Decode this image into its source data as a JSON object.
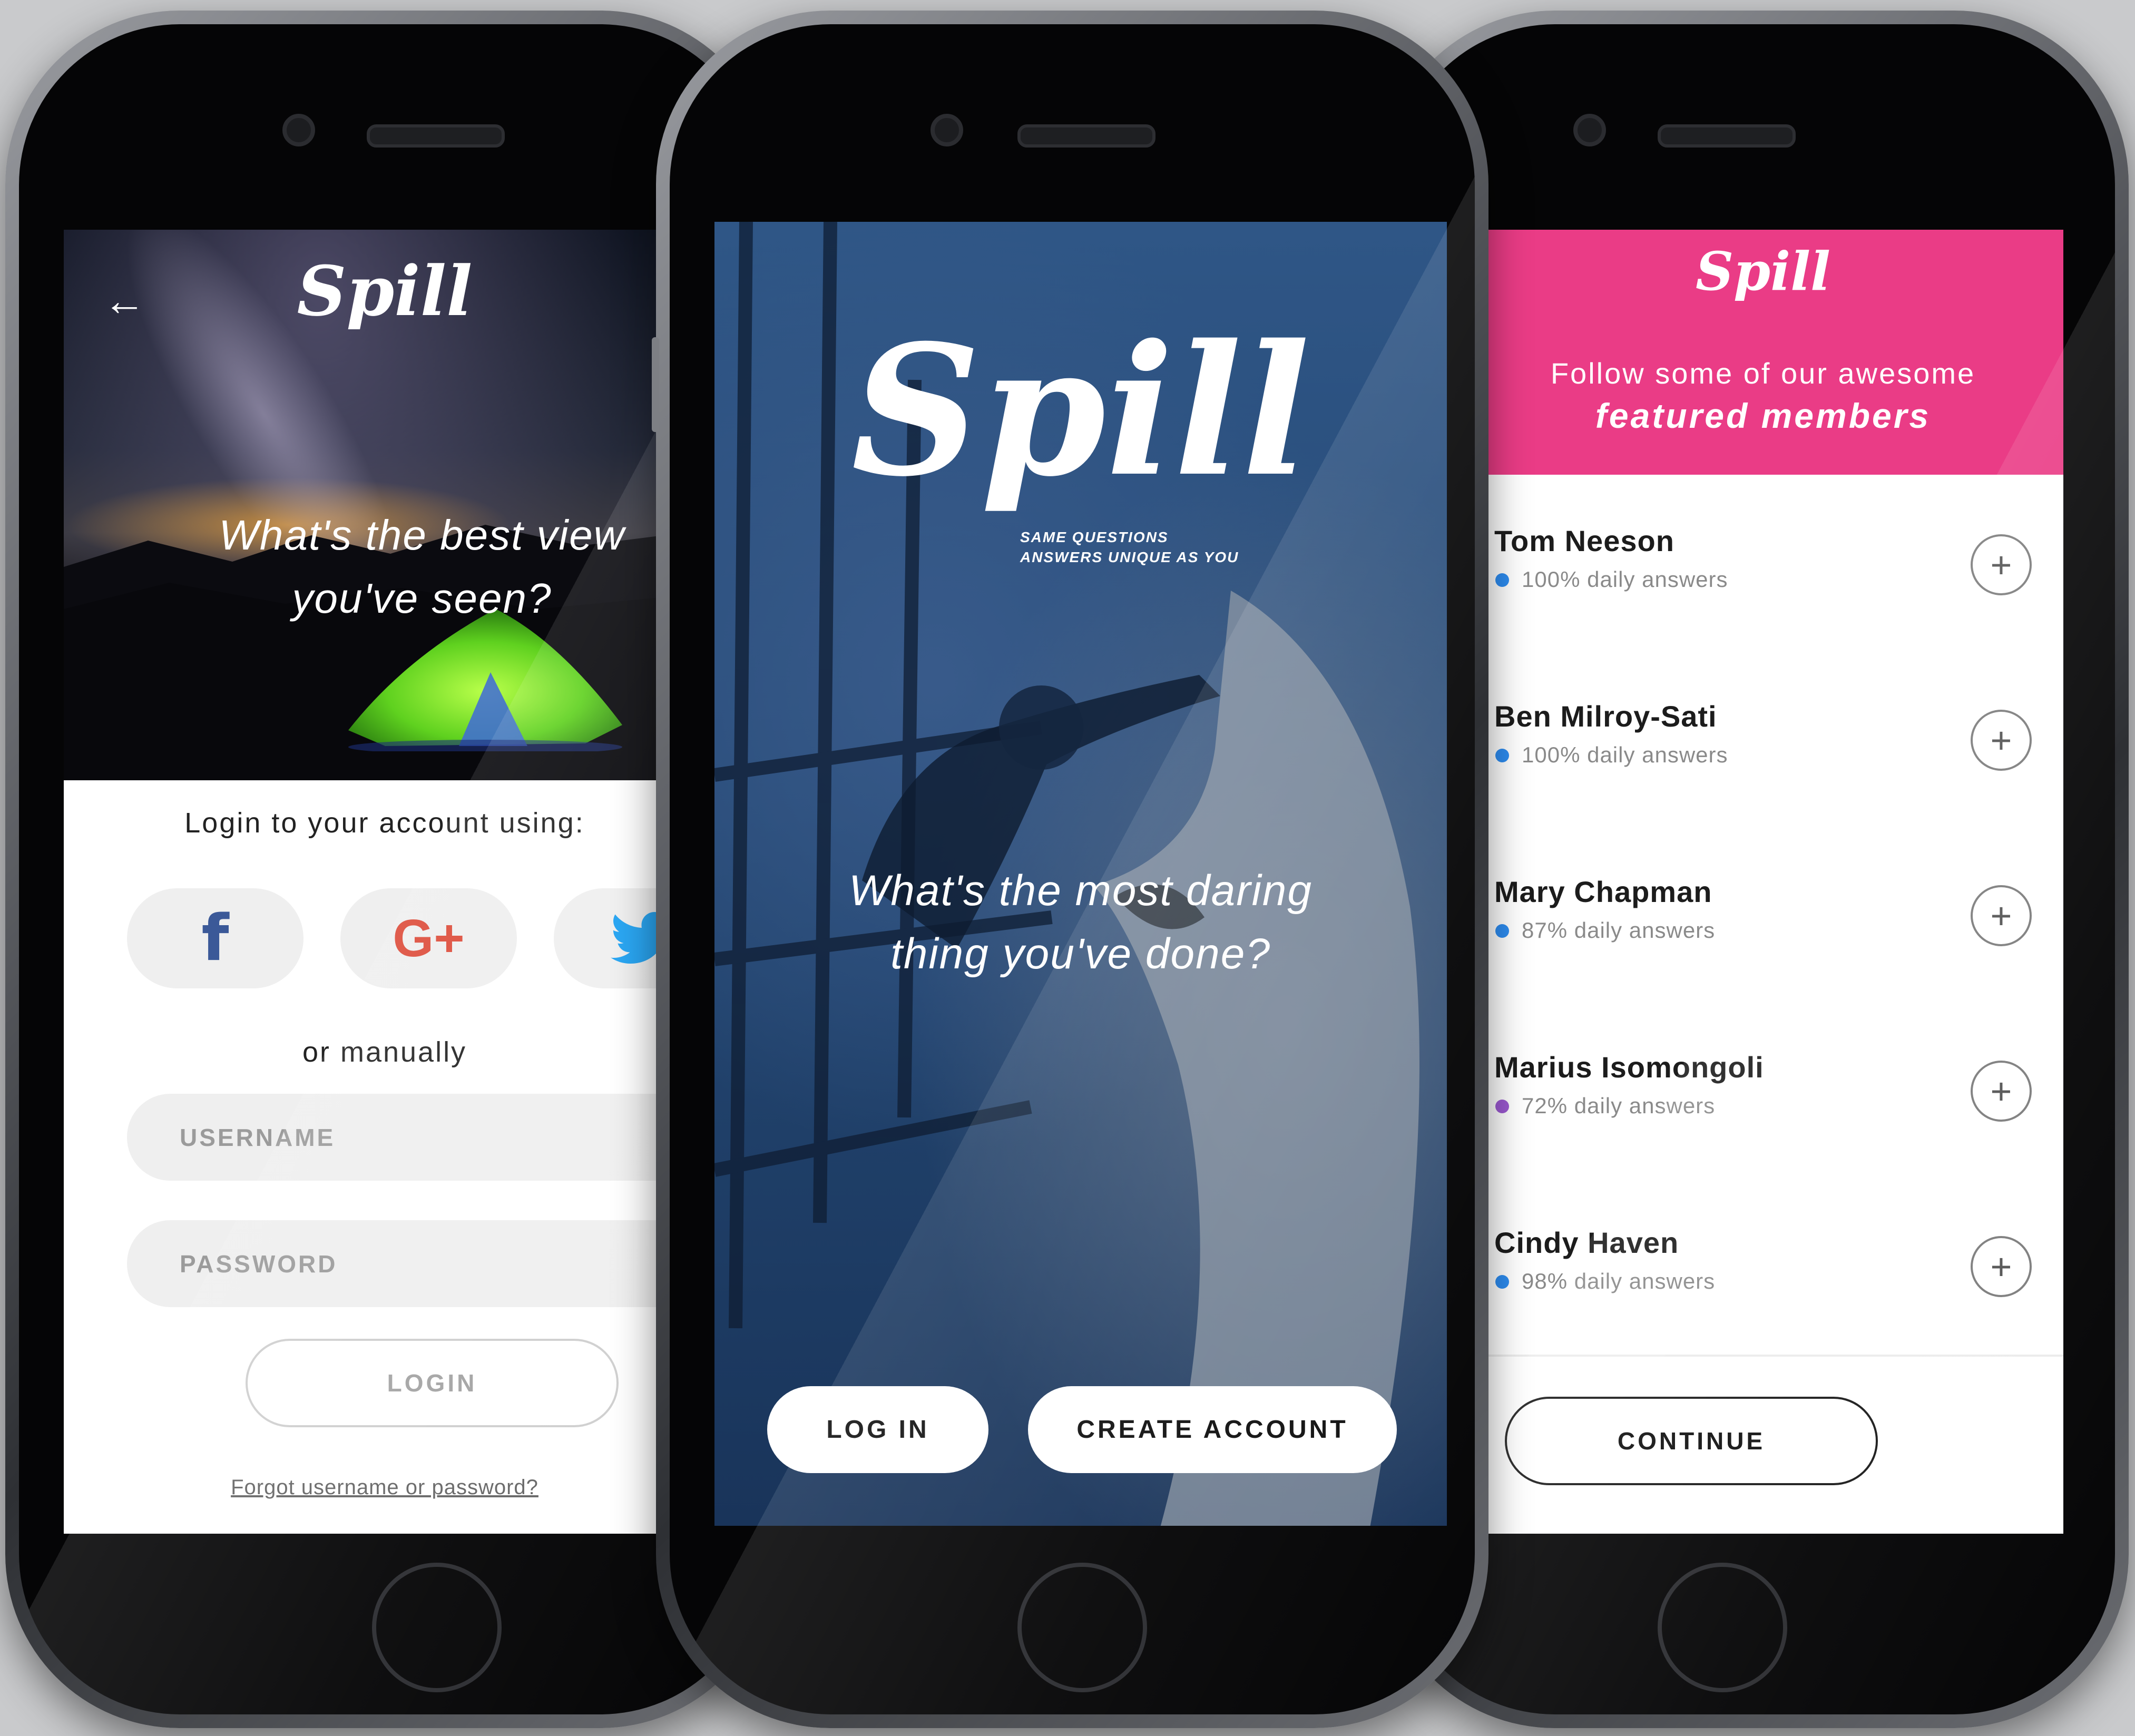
{
  "app": {
    "name": "Spill"
  },
  "login_screen": {
    "back_icon": "arrow-left-icon",
    "logo": "Spill",
    "question_line1": "What's the best view",
    "question_line2": "you've seen?",
    "prompt": "Login to your account using:",
    "social": [
      {
        "name": "facebook",
        "glyph": "f",
        "color": "#3b5998"
      },
      {
        "name": "google-plus",
        "glyph": "G+",
        "color": "#dd4b39"
      },
      {
        "name": "twitter",
        "glyph": "twitter-bird",
        "color": "#1da1f2"
      }
    ],
    "or_text": "or manually",
    "username_placeholder": "USERNAME",
    "password_placeholder": "PASSWORD",
    "login_label": "LOGIN",
    "forgot_link": "Forgot username or password?"
  },
  "splash_screen": {
    "logo": "Spill",
    "tagline_line1": "SAME QUESTIONS",
    "tagline_line2": "ANSWERS UNIQUE AS YOU",
    "question_line1": "What's the most daring",
    "question_line2": "thing you've done?",
    "login_label": "LOG IN",
    "create_label": "CREATE ACCOUNT"
  },
  "featured_screen": {
    "logo": "Spill",
    "header_line1": "Follow some of our awesome",
    "header_line2": "featured members",
    "accent_color": "#ea3c86",
    "members": [
      {
        "name": "Tom Neeson",
        "stat": "100% daily answers",
        "dot_color": "#2d8cf0"
      },
      {
        "name": "Ben Milroy-Sati",
        "stat": "100% daily answers",
        "dot_color": "#2d8cf0"
      },
      {
        "name": "Mary Chapman",
        "stat": "87% daily answers",
        "dot_color": "#2d8cf0"
      },
      {
        "name": "Marius Isomongoli",
        "stat": "72% daily answers",
        "dot_color": "#9b59d0"
      },
      {
        "name": "Cindy Haven",
        "stat": "98% daily answers",
        "dot_color": "#2d8cf0"
      }
    ],
    "follow_glyph": "+",
    "continue_label": "CONTINUE"
  }
}
